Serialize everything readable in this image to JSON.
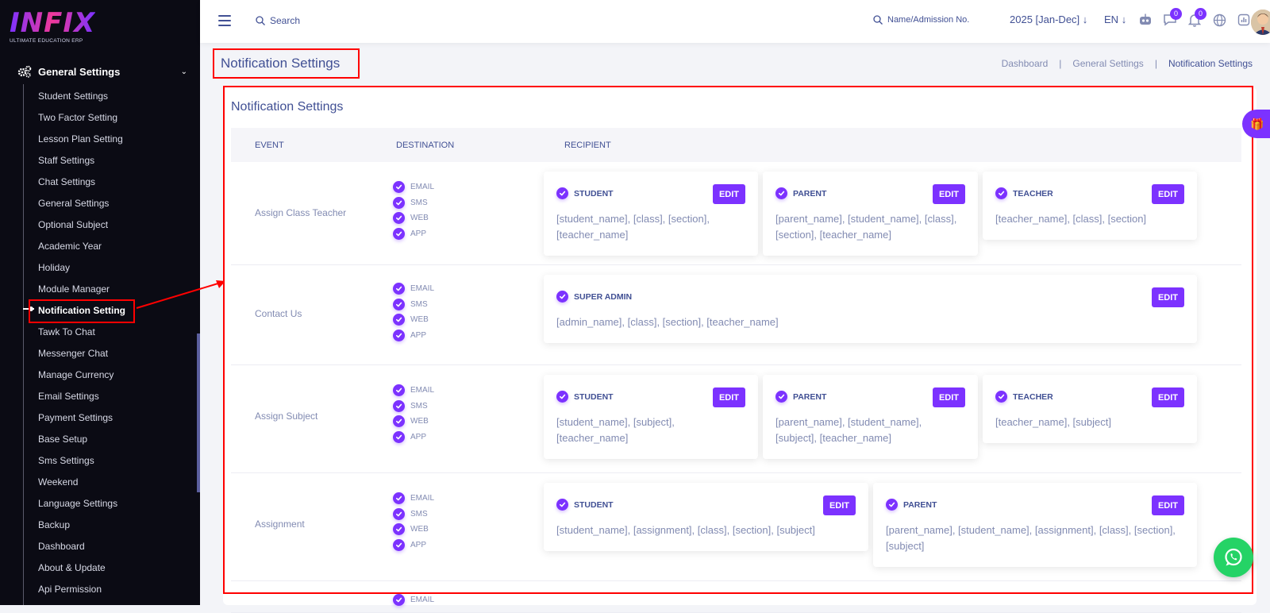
{
  "app": {
    "logo": "INFIX",
    "tagline": "ULTIMATE EDUCATION ERP"
  },
  "sidebar": {
    "group_label": "General Settings",
    "items": [
      "Student Settings",
      "Two Factor Setting",
      "Lesson Plan Setting",
      "Staff Settings",
      "Chat Settings",
      "General Settings",
      "Optional Subject",
      "Academic Year",
      "Holiday",
      "Module Manager",
      "Notification Setting",
      "Tawk To Chat",
      "Messenger Chat",
      "Manage Currency",
      "Email Settings",
      "Payment Settings",
      "Base Setup",
      "Sms Settings",
      "Weekend",
      "Language Settings",
      "Backup",
      "Dashboard",
      "About & Update",
      "Api Permission"
    ],
    "active": "Notification Setting"
  },
  "topbar": {
    "search_label": "Search",
    "admission_label": "Name/Admission No.",
    "year": "2025 [Jan-Dec]",
    "lang": "EN",
    "chat_badge": "0",
    "notif_badge": "0"
  },
  "page": {
    "title": "Notification Settings",
    "breadcrumb": [
      "Dashboard",
      "General Settings",
      "Notification Settings"
    ]
  },
  "card": {
    "title": "Notification Settings",
    "columns": [
      "EVENT",
      "DESTINATION",
      "RECIPIENT"
    ],
    "destinations": [
      "EMAIL",
      "SMS",
      "WEB",
      "APP"
    ],
    "edit_label": "EDIT",
    "rows": [
      {
        "event": "Assign Class Teacher",
        "recipients": [
          {
            "role": "STUDENT",
            "vars": "[student_name], [class], [section], [teacher_name]"
          },
          {
            "role": "PARENT",
            "vars": "[parent_name], [student_name], [class], [section], [teacher_name]"
          },
          {
            "role": "TEACHER",
            "vars": "[teacher_name], [class], [section]"
          }
        ]
      },
      {
        "event": "Contact Us",
        "recipients": [
          {
            "role": "SUPER ADMIN",
            "vars": "[admin_name], [class], [section], [teacher_name]"
          }
        ]
      },
      {
        "event": "Assign Subject",
        "recipients": [
          {
            "role": "STUDENT",
            "vars": "[student_name], [subject], [teacher_name]"
          },
          {
            "role": "PARENT",
            "vars": "[parent_name], [student_name], [subject], [teacher_name]"
          },
          {
            "role": "TEACHER",
            "vars": "[teacher_name], [subject]"
          }
        ]
      },
      {
        "event": "Assignment",
        "recipients": [
          {
            "role": "STUDENT",
            "vars": "[student_name], [assignment], [class], [section], [subject]"
          },
          {
            "role": "PARENT",
            "vars": "[parent_name], [student_name], [assignment], [class], [section], [subject]"
          }
        ]
      },
      {
        "event": "",
        "partial_destination": "EMAIL"
      }
    ]
  },
  "colors": {
    "accent": "#7c32ff",
    "text": "#415094",
    "muted": "#828bb2",
    "annotation": "#ff0000"
  }
}
